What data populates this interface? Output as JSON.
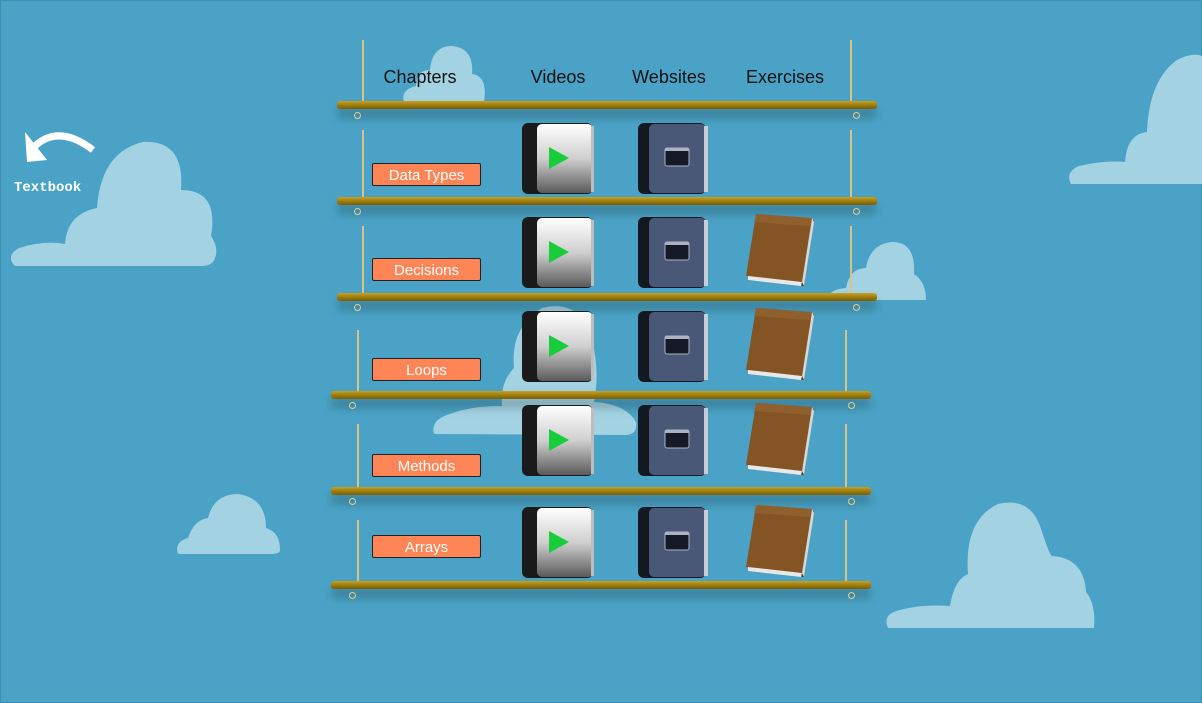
{
  "navigation": {
    "back_label": "Textbook",
    "back_icon": "undo-arrow-icon"
  },
  "headers": {
    "chapters": "Chapters",
    "videos": "Videos",
    "websites": "Websites",
    "exercises": "Exercises"
  },
  "chapters": [
    {
      "label": "Data Types",
      "has_video": true,
      "has_website": true,
      "has_exercise": false
    },
    {
      "label": "Decisions",
      "has_video": true,
      "has_website": true,
      "has_exercise": true
    },
    {
      "label": "Loops",
      "has_video": true,
      "has_website": true,
      "has_exercise": true
    },
    {
      "label": "Methods",
      "has_video": true,
      "has_website": true,
      "has_exercise": true
    },
    {
      "label": "Arrays",
      "has_video": true,
      "has_website": true,
      "has_exercise": true
    }
  ],
  "colors": {
    "background": "#4aa3c6",
    "cloud": "#a3d3e3",
    "chapter_button": "#ff8557",
    "play": "#18cc3c",
    "book": "#7a4a1c",
    "shelf": "#b8921a"
  }
}
